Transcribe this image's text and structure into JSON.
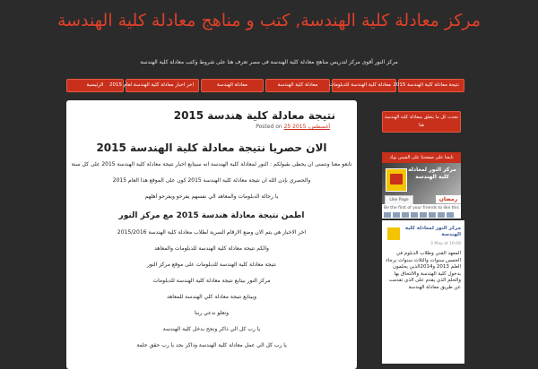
{
  "site": {
    "title": "مركز معادلة كلية الهندسة, كتب و مناهج معادلة كلية الهندسة",
    "tagline": "مركز النور أقوى مركز لتدريس مناهج معادلة كلية الهندسة فى مصر تعرف هنا على شروط وكتب معادلة كلية الهندسة"
  },
  "nav": {
    "items": [
      "نتيجة معادلة كلية الهندسة 2015",
      "معادلة كلية الهندسة للدبلومات",
      "معادلة كلية الهندسة",
      "معادلة الهندسة",
      "اخر اخبار معادلة كلية الهندسة لعام 2015",
      "الرئيسية"
    ]
  },
  "post": {
    "title": "نتيجة معادلة كلية هندسة 2015",
    "meta_posted_on": "Posted on",
    "meta_date": "25 أغسطس، 2015",
    "heading1": "الان حصريا نتيجة معادلة كلية الهندسة 2015",
    "line1": "تابعو معنا ونتمنى ان يحظى بقبولكم : النور لمعادلة كلية الهندسة انه سيتابع اخبار نتيجة معادلة كلية الهندسة 2015 على كل سنة",
    "line2": "والحصري بإذن الله ان نتيجة معادلة كلية الهندسة 2015 كون على الموقع هذا العام 2015",
    "line3": "يا رجالة الدبلومات والمعاهد الي نفسهم يفرحو ويفرحو اهلهم",
    "heading2": "اطمن   نتيجة معادلة هندسة 2015 مع مركز النور",
    "line4": "اخر الاخبار هي يتم الان وضع الارقام السرية لطلاب معادلة كلية الهندسة 2015/2016",
    "line5": "والكم   نتيجة معادلة كلية الهندسة للدبلومات والمعاهد",
    "line6": "نتيجة معادلة كلية الهندسة للدبلومات على موقع مركز النور",
    "line7": "مركز النور بيتابع نتيجة معادلة كلية الهندسة للدبلومات",
    "line8": "وبيتابع نتيجة معادلة كلي الهندسة للمعاهد",
    "line9": "وتعلو ندعي ربنا",
    "line10": "يا رب كل الي ذاكر ونجح بدخل كلية الهندسة",
    "line11": "يا رب كل الي عمل معادلة كلية الهندسة وذاكر بجد يا رب حقق حلمة"
  },
  "sidebar": {
    "subscribe_text": "تحدث كل ما يتعلق بمعادلة كلية الهندسة هنا",
    "fb_header": "تابعنا على صفحتنا على الفيس بوك",
    "fb_page_name": "مركز النور لمعادلة كلية الهندسة",
    "fb_like": "Like Page",
    "fb_friends": "Be the first of your friends to like this",
    "fb_post_name": "مركز النور لمعادلة كلية الهندسة",
    "fb_post_date": "3 May at 16:09",
    "fb_post_text": "المعهد الفني وطلاب الدبلوم في الخمس سنوات والثلاث سنوات برجاء العلم 2013 و2014الذين يحلمون بدخول كلية الهندسة والالتحاق بها والحلم الذي يقدم على الذي تقدمت عن طريق معادلة الهندسة"
  },
  "colors": {
    "accent": "#c9301c",
    "background": "#2b2b2b",
    "title": "#e0402a"
  }
}
